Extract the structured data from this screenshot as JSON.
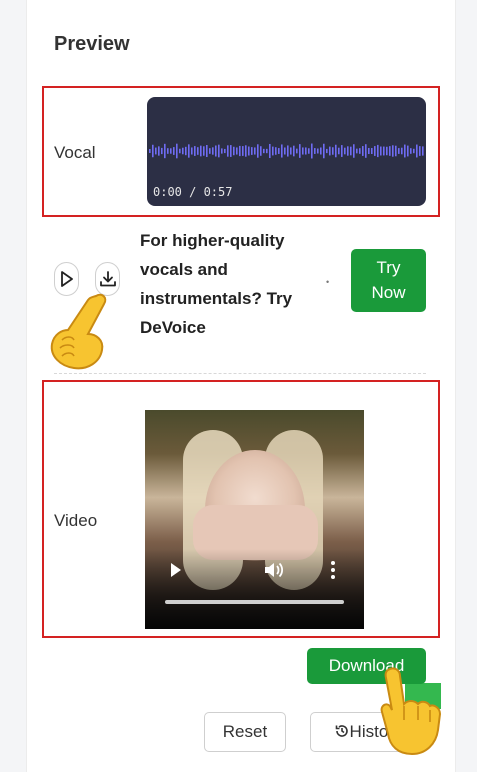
{
  "preview": {
    "title": "Preview",
    "vocal_label": "Vocal",
    "video_label": "Video",
    "audio_time": "0:00 / 0:57",
    "promo_lines": [
      "For higher-quality",
      "vocals and",
      "instrumentals? Try",
      "DeVoice"
    ],
    "promo_mark": "•",
    "try_button": [
      "Try",
      "Now"
    ],
    "download_button": "Download",
    "reset_button": "Reset",
    "history_button": "History"
  },
  "colors": {
    "accent_green": "#1a9a3a",
    "highlight_red": "#d42222",
    "audio_bg": "#2c2f45",
    "wave": "#6f6cf2"
  },
  "icons": [
    "play-icon",
    "download-icon",
    "pointing-hand-icon",
    "video-play-icon",
    "volume-icon",
    "more-vertical-icon",
    "history-icon"
  ]
}
